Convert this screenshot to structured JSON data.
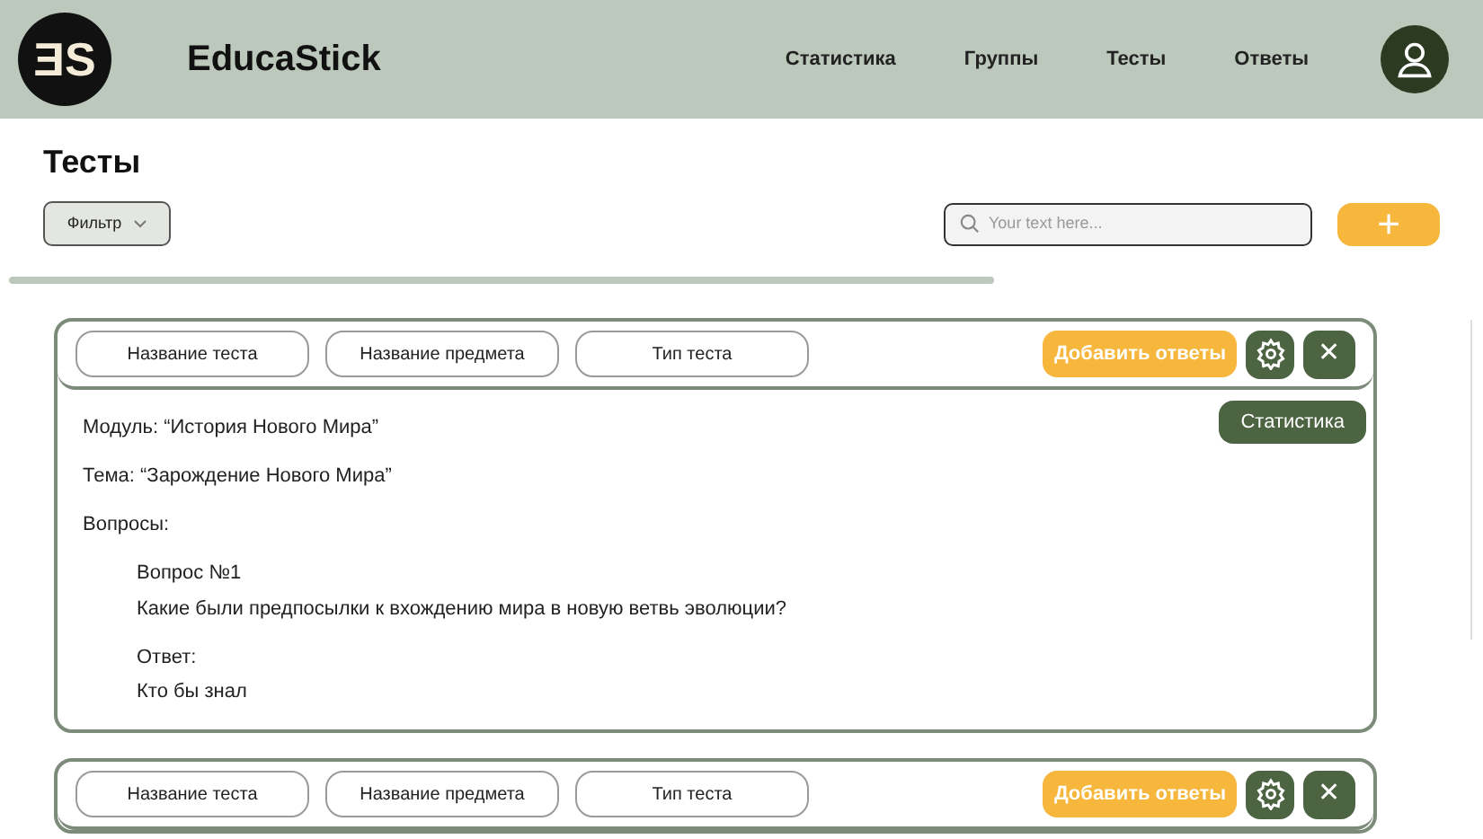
{
  "header": {
    "logo": "ƎS",
    "brand": "EducaStick",
    "nav": [
      {
        "label": "Статистика",
        "selected": false
      },
      {
        "label": "Группы",
        "selected": false
      },
      {
        "label": "Тесты",
        "selected": false
      },
      {
        "label": "Ответы",
        "selected": false
      }
    ]
  },
  "page_title": "Тесты",
  "filter": {
    "label": "Фильтр"
  },
  "search": {
    "placeholder": "Your text here..."
  },
  "add_button": "+",
  "cards": [
    {
      "tags": [
        "Название теста",
        "Название предмета",
        "Тип теста"
      ],
      "add_answers": "Добавить ответы",
      "close": "✕",
      "body": {
        "statistics": "Статистика",
        "lines": [
          "Модуль: “История Нового Мира”",
          "Тема: “Зарождение Нового Мира”",
          "Вопросы:"
        ],
        "questions": [
          {
            "title": "Вопрос №1",
            "text": "Какие были предпосылки к вхождению мира в новую ветвь эволюции?",
            "answer_label": "Ответ:",
            "answer": "Кто бы знал"
          }
        ]
      }
    },
    {
      "tags": [
        "Название теста",
        "Название предмета",
        "Тип теста"
      ],
      "add_answers": "Добавить ответы",
      "close": "✕"
    }
  ]
}
